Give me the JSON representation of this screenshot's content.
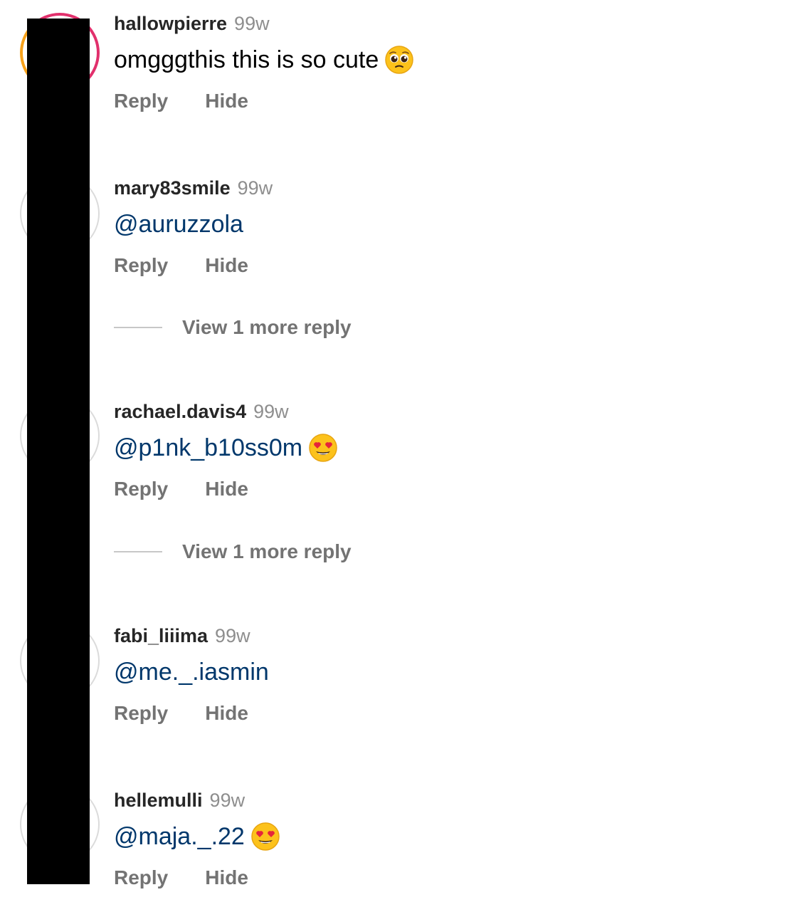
{
  "comments": [
    {
      "username": "hallowpierre",
      "time": "99w",
      "text": "omgggthis this is so cute",
      "emoji": "pleading-face-emoji",
      "reply_label": "Reply",
      "hide_label": "Hide"
    },
    {
      "username": "mary83smile",
      "time": "99w",
      "text": "@auruzzola",
      "reply_label": "Reply",
      "hide_label": "Hide",
      "more_replies": "View 1 more reply"
    },
    {
      "username": "rachael.davis4",
      "time": "99w",
      "text": "@p1nk_b10ss0m",
      "emoji": "heart-eyes-emoji",
      "reply_label": "Reply",
      "hide_label": "Hide",
      "more_replies": "View 1 more reply"
    },
    {
      "username": "fabi_liiima",
      "time": "99w",
      "text": "@me._.iasmin",
      "reply_label": "Reply",
      "hide_label": "Hide"
    },
    {
      "username": "hellemulli",
      "time": "99w",
      "text": "@maja._.22",
      "emoji": "heart-eyes-emoji",
      "reply_label": "Reply",
      "hide_label": "Hide"
    }
  ],
  "colors": {
    "username": "#262626",
    "timestamp": "#8e8e8e",
    "mention": "#00376b",
    "action": "#737373",
    "redaction": "#000000"
  }
}
